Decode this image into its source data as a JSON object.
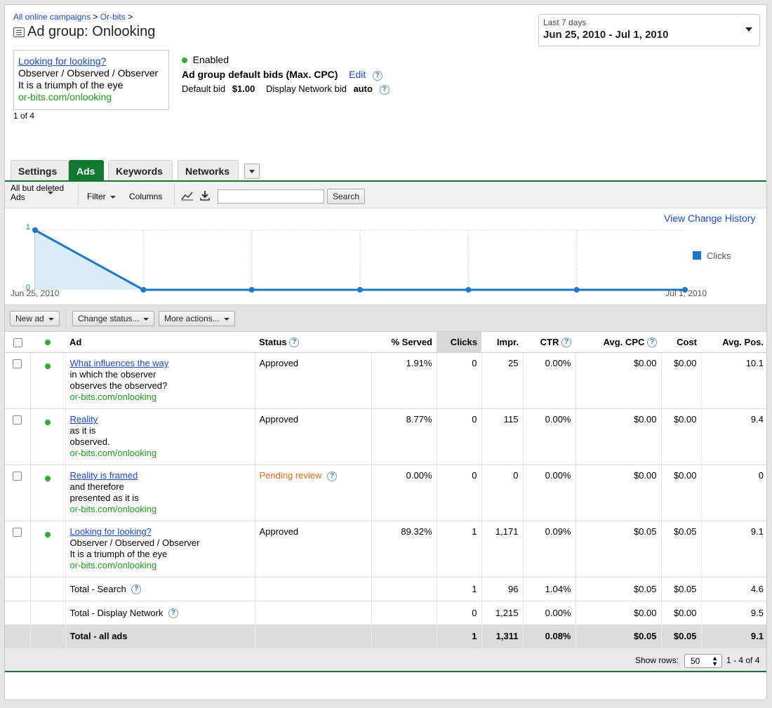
{
  "breadcrumb": {
    "items": [
      "All online campaigns",
      "Or-bits"
    ],
    "separator": ">"
  },
  "page": {
    "title_prefix": "Ad group:",
    "title_name": "Onlooking"
  },
  "date_range": {
    "label": "Last 7 days",
    "range": "Jun 25, 2010 - Jul 1, 2010"
  },
  "ad_preview": {
    "headline": "Looking for looking?",
    "line1": "Observer / Observed / Observer",
    "line2": "It is a triumph of the eye",
    "url": "or-bits.com/onlooking",
    "counter": "1 of 4"
  },
  "status": {
    "state": "Enabled",
    "bids_heading": "Ad group default bids (Max. CPC)",
    "edit_label": "Edit",
    "default_bid_label": "Default bid",
    "default_bid_value": "$1.00",
    "display_bid_label": "Display Network bid",
    "display_bid_value": "auto"
  },
  "tabs": [
    "Settings",
    "Ads",
    "Keywords",
    "Networks"
  ],
  "active_tab": "Ads",
  "toolbar": {
    "view_filter_line1": "All but deleted",
    "view_filter_line2": "Ads",
    "filter_label": "Filter",
    "columns_label": "Columns",
    "search_label": "Search",
    "search_value": ""
  },
  "chart_links": {
    "view_change_history": "View Change History"
  },
  "chart_data": {
    "type": "line",
    "x": [
      "Jun 25, 2010",
      "Jun 26, 2010",
      "Jun 27, 2010",
      "Jun 28, 2010",
      "Jun 29, 2010",
      "Jun 30, 2010",
      "Jul 1, 2010"
    ],
    "x_tick_labels": [
      "Jun 25, 2010",
      "Jul 1, 2010"
    ],
    "series": [
      {
        "name": "Clicks",
        "values": [
          1,
          0,
          0,
          0,
          0,
          0,
          0
        ],
        "color": "#1979d0"
      }
    ],
    "ylim": [
      0,
      1
    ],
    "y_tick_labels": [
      "0",
      "1"
    ],
    "grid": true,
    "legend": "right"
  },
  "actions": {
    "new_ad": "New ad",
    "change_status": "Change status...",
    "more_actions": "More actions..."
  },
  "table": {
    "headers": {
      "ad": "Ad",
      "status": "Status",
      "served": "% Served",
      "clicks": "Clicks",
      "impr": "Impr.",
      "ctr": "CTR",
      "avg_cpc": "Avg. CPC",
      "cost": "Cost",
      "avg_pos": "Avg. Pos."
    },
    "rows": [
      {
        "headline": "What influences the way",
        "line1": "in which the observer",
        "line2": "observes the observed?",
        "url": "or-bits.com/onlooking",
        "status": "Approved",
        "served": "1.91%",
        "clicks": "0",
        "impr": "25",
        "ctr": "0.00%",
        "avg_cpc": "$0.00",
        "cost": "$0.00",
        "avg_pos": "10.1"
      },
      {
        "headline": "Reality",
        "line1": "as it is",
        "line2": "observed.",
        "url": "or-bits.com/onlooking",
        "status": "Approved",
        "served": "8.77%",
        "clicks": "0",
        "impr": "115",
        "ctr": "0.00%",
        "avg_cpc": "$0.00",
        "cost": "$0.00",
        "avg_pos": "9.4"
      },
      {
        "headline": "Reality is framed",
        "line1": "and therefore",
        "line2": "presented as it is",
        "url": "or-bits.com/onlooking",
        "status": "Pending review",
        "served": "0.00%",
        "clicks": "0",
        "impr": "0",
        "ctr": "0.00%",
        "avg_cpc": "$0.00",
        "cost": "$0.00",
        "avg_pos": "0"
      },
      {
        "headline": "Looking for looking?",
        "line1": "Observer / Observed / Observer",
        "line2": "It is a triumph of the eye",
        "url": "or-bits.com/onlooking",
        "status": "Approved",
        "served": "89.32%",
        "clicks": "1",
        "impr": "1,171",
        "ctr": "0.09%",
        "avg_cpc": "$0.05",
        "cost": "$0.05",
        "avg_pos": "9.1"
      }
    ],
    "totals": [
      {
        "label": "Total - Search",
        "clicks": "1",
        "impr": "96",
        "ctr": "1.04%",
        "avg_cpc": "$0.05",
        "cost": "$0.05",
        "avg_pos": "4.6"
      },
      {
        "label": "Total - Display Network",
        "clicks": "0",
        "impr": "1,215",
        "ctr": "0.00%",
        "avg_cpc": "$0.00",
        "cost": "$0.00",
        "avg_pos": "9.5"
      },
      {
        "label": "Total - all ads",
        "clicks": "1",
        "impr": "1,311",
        "ctr": "0.08%",
        "avg_cpc": "$0.05",
        "cost": "$0.05",
        "avg_pos": "9.1"
      }
    ]
  },
  "pagination": {
    "show_rows_label": "Show rows:",
    "rows_value": "50",
    "range": "1 - 4 of 4"
  },
  "colors": {
    "accent_green": "#0f7a2f",
    "link_blue": "#1a4bd6",
    "chart_blue": "#1979d0",
    "status_green": "#2bb22b",
    "pending_orange": "#ee6611"
  }
}
